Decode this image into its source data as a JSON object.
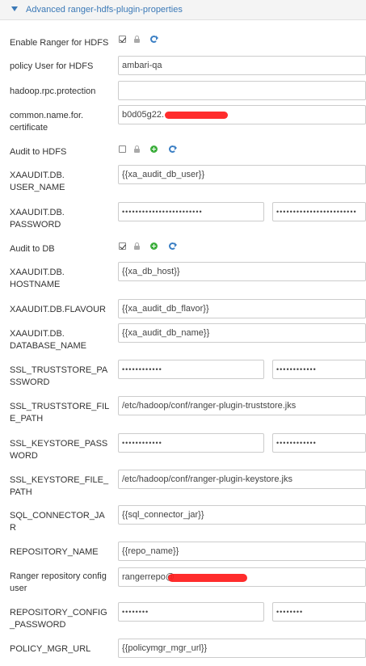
{
  "panel": {
    "title": "Advanced ranger-hdfs-plugin-properties"
  },
  "fields": {
    "enable_ranger": {
      "label": "Enable Ranger for HDFS"
    },
    "policy_user": {
      "label": "policy User for HDFS",
      "value": "ambari-qa"
    },
    "rpc_protection": {
      "label": "hadoop.rpc.protection",
      "value": ""
    },
    "common_name": {
      "label": "common.name.for.\ncertificate",
      "value": "b0d05g22."
    },
    "audit_hdfs": {
      "label": "Audit to HDFS"
    },
    "xa_user": {
      "label": "XAAUDIT.DB.\nUSER_NAME",
      "value": "{{xa_audit_db_user}}"
    },
    "xa_password": {
      "label": "XAAUDIT.DB.\nPASSWORD",
      "value": "••••••••••••••••••••••••",
      "confirm": "••••••••••••••••••••••••"
    },
    "audit_db": {
      "label": "Audit to DB"
    },
    "xa_hostname": {
      "label": "XAAUDIT.DB.\nHOSTNAME",
      "value": "{{xa_db_host}}"
    },
    "xa_flavour": {
      "label": "XAAUDIT.DB.FLAVOUR",
      "value": "{{xa_audit_db_flavor}}"
    },
    "xa_dbname": {
      "label": "XAAUDIT.DB.\nDATABASE_NAME",
      "value": "{{xa_audit_db_name}}"
    },
    "ssl_truststore_pw": {
      "label": "SSL_TRUSTSTORE_PA\nSSWORD",
      "value": "••••••••••••",
      "confirm": "••••••••••••"
    },
    "ssl_truststore_path": {
      "label": "SSL_TRUSTSTORE_FIL\nE_PATH",
      "value": "/etc/hadoop/conf/ranger-plugin-truststore.jks"
    },
    "ssl_keystore_pw": {
      "label": "SSL_KEYSTORE_PASS\nWORD",
      "value": "••••••••••••",
      "confirm": "••••••••••••"
    },
    "ssl_keystore_path": {
      "label": "SSL_KEYSTORE_FILE_\nPATH",
      "value": "/etc/hadoop/conf/ranger-plugin-keystore.jks"
    },
    "sql_connector": {
      "label": "SQL_CONNECTOR_JA\nR",
      "value": "{{sql_connector_jar}}"
    },
    "repository_name": {
      "label": "REPOSITORY_NAME",
      "value": "{{repo_name}}"
    },
    "repo_config_user": {
      "label": "Ranger repository config\nuser",
      "value": "rangerrepo@"
    },
    "repo_config_pw": {
      "label": "REPOSITORY_CONFIG\n_PASSWORD",
      "value": "••••••••",
      "confirm": "••••••••"
    },
    "policy_mgr_url": {
      "label": "POLICY_MGR_URL",
      "value": "{{policymgr_mgr_url}}"
    }
  },
  "colors": {
    "link": "#3b79b7",
    "add": "#3cae3c",
    "redaction": "#ff1a1a"
  }
}
